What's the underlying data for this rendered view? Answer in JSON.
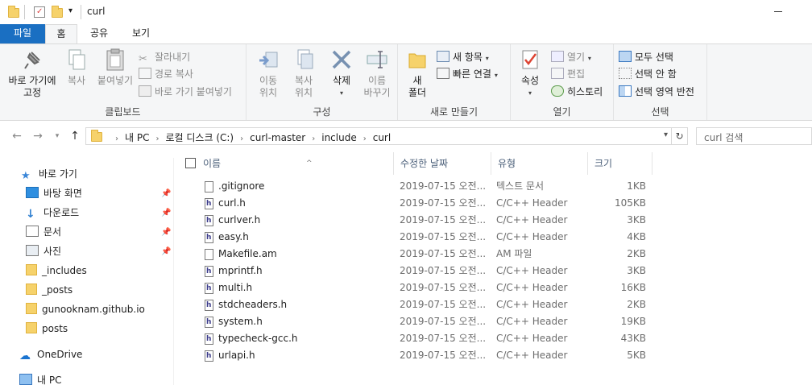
{
  "window": {
    "title": "curl"
  },
  "ribbon_tabs": [
    "파일",
    "홈",
    "공유",
    "보기"
  ],
  "clipboard": {
    "pin_label": "바로 가기에\n고정",
    "copy_label": "복사",
    "paste_label": "붙여넣기",
    "cut_label": "잘라내기",
    "copy_path_label": "경로 복사",
    "paste_shortcut_label": "바로 가기 붙여넣기",
    "group_label": "클립보드"
  },
  "organize": {
    "move_label": "이동\n위치",
    "copy_to_label": "복사\n위치",
    "delete_label": "삭제",
    "rename_label": "이름\n바꾸기",
    "group_label": "구성"
  },
  "new": {
    "new_folder_label": "새\n폴더",
    "new_item_label": "새 항목",
    "easy_access_label": "빠른 연결",
    "group_label": "새로 만들기"
  },
  "open": {
    "properties_label": "속성",
    "open_label": "열기",
    "edit_label": "편집",
    "history_label": "히스토리",
    "group_label": "열기"
  },
  "select": {
    "select_all_label": "모두 선택",
    "select_none_label": "선택 안 함",
    "invert_label": "선택 영역 반전",
    "group_label": "선택"
  },
  "address": {
    "crumbs": [
      "내 PC",
      "로컬 디스크 (C:)",
      "curl-master",
      "include",
      "curl"
    ],
    "search_placeholder": "curl 검색"
  },
  "nav": {
    "quick_access": "바로 가기",
    "items": [
      {
        "label": "바탕 화면",
        "pinned": true
      },
      {
        "label": "다운로드",
        "pinned": true
      },
      {
        "label": "문서",
        "pinned": true
      },
      {
        "label": "사진",
        "pinned": true
      },
      {
        "label": "_includes",
        "pinned": false
      },
      {
        "label": "_posts",
        "pinned": false
      },
      {
        "label": "gunooknam.github.io",
        "pinned": false
      },
      {
        "label": "posts",
        "pinned": false
      }
    ],
    "onedrive": "OneDrive",
    "this_pc": "내 PC"
  },
  "columns": {
    "name": "이름",
    "date": "수정한 날짜",
    "type": "유형",
    "size": "크기"
  },
  "files": [
    {
      "name": ".gitignore",
      "date": "2019-07-15 오전...",
      "type": "텍스트 문서",
      "size": "1KB",
      "kind": "txt"
    },
    {
      "name": "curl.h",
      "date": "2019-07-15 오전...",
      "type": "C/C++ Header",
      "size": "105KB",
      "kind": "h"
    },
    {
      "name": "curlver.h",
      "date": "2019-07-15 오전...",
      "type": "C/C++ Header",
      "size": "3KB",
      "kind": "h"
    },
    {
      "name": "easy.h",
      "date": "2019-07-15 오전...",
      "type": "C/C++ Header",
      "size": "4KB",
      "kind": "h"
    },
    {
      "name": "Makefile.am",
      "date": "2019-07-15 오전...",
      "type": "AM 파일",
      "size": "2KB",
      "kind": "txt"
    },
    {
      "name": "mprintf.h",
      "date": "2019-07-15 오전...",
      "type": "C/C++ Header",
      "size": "3KB",
      "kind": "h"
    },
    {
      "name": "multi.h",
      "date": "2019-07-15 오전...",
      "type": "C/C++ Header",
      "size": "16KB",
      "kind": "h"
    },
    {
      "name": "stdcheaders.h",
      "date": "2019-07-15 오전...",
      "type": "C/C++ Header",
      "size": "2KB",
      "kind": "h"
    },
    {
      "name": "system.h",
      "date": "2019-07-15 오전...",
      "type": "C/C++ Header",
      "size": "19KB",
      "kind": "h"
    },
    {
      "name": "typecheck-gcc.h",
      "date": "2019-07-15 오전...",
      "type": "C/C++ Header",
      "size": "43KB",
      "kind": "h"
    },
    {
      "name": "urlapi.h",
      "date": "2019-07-15 오전...",
      "type": "C/C++ Header",
      "size": "5KB",
      "kind": "h"
    }
  ],
  "colors": {
    "file_tab": "#1a6fc2",
    "folder": "#f6d26b",
    "header_text": "#4c607a"
  }
}
